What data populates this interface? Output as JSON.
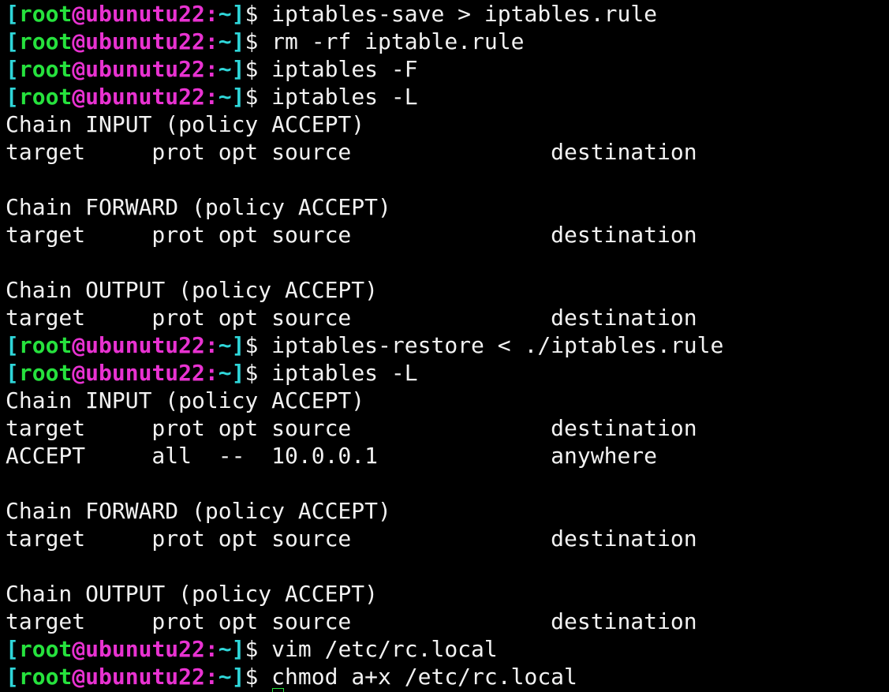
{
  "prompt": {
    "open_bracket": "[",
    "user": "root",
    "at": "@",
    "host": "ubunutu22",
    "colon": ":",
    "path": "~",
    "close_bracket": "]",
    "dollar": "$ "
  },
  "colors": {
    "bracket": "#2fd6d9",
    "user": "#26e23d",
    "host": "#e832d1",
    "text": "#f2f2f2",
    "background": "#000000"
  },
  "lines": [
    {
      "type": "prompt",
      "text": "iptables-save > iptables.rule"
    },
    {
      "type": "prompt",
      "text": "rm -rf iptable.rule"
    },
    {
      "type": "prompt",
      "text": "iptables -F"
    },
    {
      "type": "prompt",
      "text": "iptables -L"
    },
    {
      "type": "output",
      "text": "Chain INPUT (policy ACCEPT)"
    },
    {
      "type": "output",
      "text": "target     prot opt source               destination"
    },
    {
      "type": "output",
      "text": ""
    },
    {
      "type": "output",
      "text": "Chain FORWARD (policy ACCEPT)"
    },
    {
      "type": "output",
      "text": "target     prot opt source               destination"
    },
    {
      "type": "output",
      "text": ""
    },
    {
      "type": "output",
      "text": "Chain OUTPUT (policy ACCEPT)"
    },
    {
      "type": "output",
      "text": "target     prot opt source               destination"
    },
    {
      "type": "prompt",
      "text": "iptables-restore < ./iptables.rule"
    },
    {
      "type": "prompt",
      "text": "iptables -L"
    },
    {
      "type": "output",
      "text": "Chain INPUT (policy ACCEPT)"
    },
    {
      "type": "output",
      "text": "target     prot opt source               destination"
    },
    {
      "type": "output",
      "text": "ACCEPT     all  --  10.0.0.1             anywhere"
    },
    {
      "type": "output",
      "text": ""
    },
    {
      "type": "output",
      "text": "Chain FORWARD (policy ACCEPT)"
    },
    {
      "type": "output",
      "text": "target     prot opt source               destination"
    },
    {
      "type": "output",
      "text": ""
    },
    {
      "type": "output",
      "text": "Chain OUTPUT (policy ACCEPT)"
    },
    {
      "type": "output",
      "text": "target     prot opt source               destination"
    },
    {
      "type": "prompt",
      "text": "vim /etc/rc.local"
    },
    {
      "type": "prompt",
      "text": "chmod a+x /etc/rc.local"
    }
  ]
}
